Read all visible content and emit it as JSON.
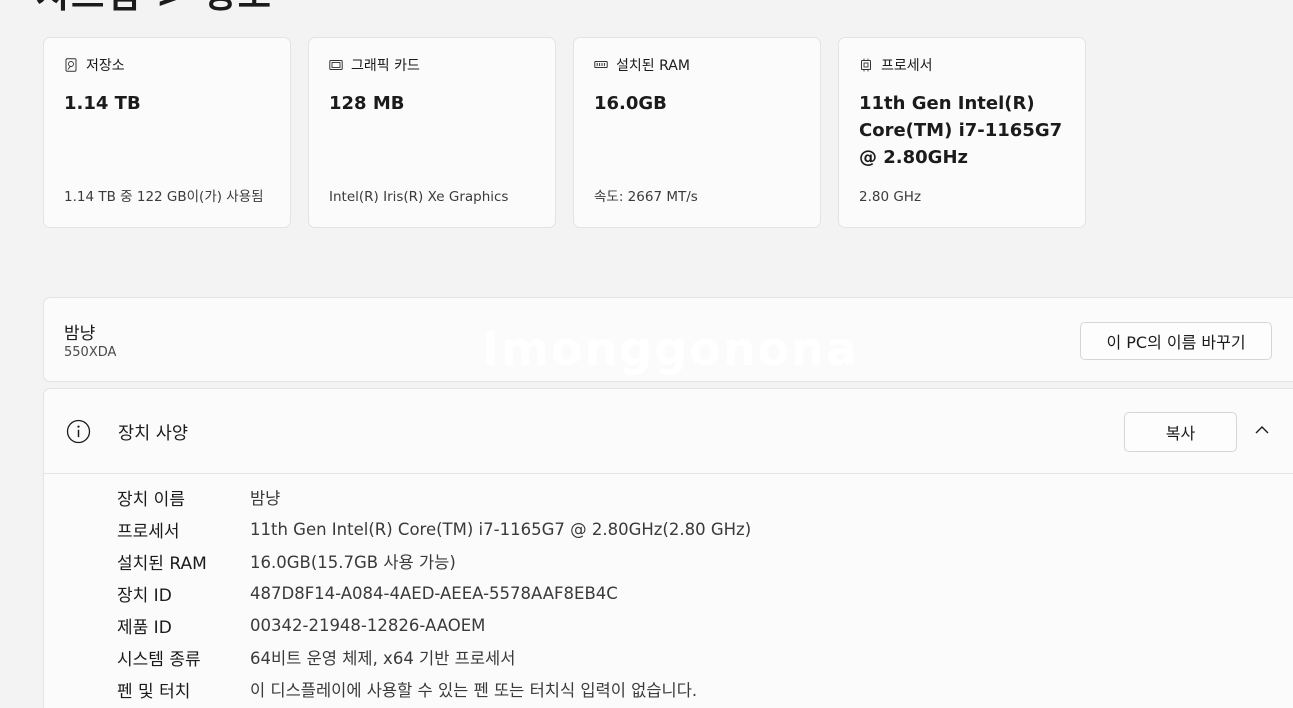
{
  "page": {
    "partial_title": "시스템 > 정보"
  },
  "cards": [
    {
      "icon": "storage-icon",
      "label": "저장소",
      "value": "1.14 TB",
      "sub": "1.14 TB 중 122 GB이(가) 사용됨"
    },
    {
      "icon": "graphics-card-icon",
      "label": "그래픽 카드",
      "value": "128 MB",
      "sub": "Intel(R) Iris(R) Xe Graphics"
    },
    {
      "icon": "ram-icon",
      "label": "설치된 RAM",
      "value": "16.0GB",
      "sub": "속도: 2667 MT/s"
    },
    {
      "icon": "processor-icon",
      "label": "프로세서",
      "value": "11th Gen Intel(R) Core(TM) i7-1165G7 @ 2.80GHz",
      "sub": "2.80 GHz"
    }
  ],
  "pc": {
    "name": "밤냥",
    "model": "550XDA",
    "watermark": "Imonggonona",
    "rename_label": "이 PC의 이름 바꾸기"
  },
  "device_spec": {
    "title": "장치 사양",
    "copy_label": "복사",
    "rows": [
      {
        "label": "장치 이름",
        "value": "밤냥"
      },
      {
        "label": "프로세서",
        "value": "11th Gen Intel(R) Core(TM) i7-1165G7 @ 2.80GHz(2.80 GHz)"
      },
      {
        "label": "설치된 RAM",
        "value": "16.0GB(15.7GB 사용 가능)"
      },
      {
        "label": "장치 ID",
        "value": "487D8F14-A084-4AED-AEEA-5578AAF8EB4C"
      },
      {
        "label": "제품 ID",
        "value": "00342-21948-12826-AAOEM"
      },
      {
        "label": "시스템 종류",
        "value": "64비트 운영 체제, x64 기반 프로세서"
      },
      {
        "label": "펜 및 터치",
        "value": "이 디스플레이에 사용할 수 있는 펜 또는 터치식 입력이 없습니다."
      }
    ]
  }
}
